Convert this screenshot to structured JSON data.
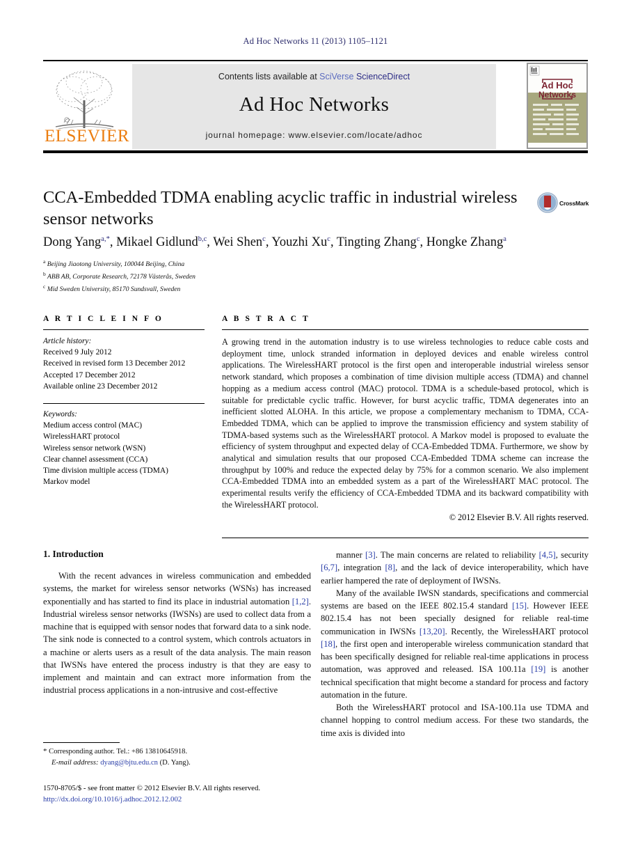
{
  "running_head": "Ad Hoc Networks 11 (2013) 1105–1121",
  "masthead": {
    "contents_prefix": "Contents lists available at ",
    "contents_link_part1": "SciVerse ",
    "contents_link_part2": "ScienceDirect",
    "journal_name": "Ad Hoc Networks",
    "homepage": "journal homepage: www.elsevier.com/locate/adhoc",
    "publisher_wordmark": "ELSEVIER",
    "cover_title_line1": "Ad Hoc",
    "cover_title_line2": "Networks"
  },
  "article": {
    "title": "CCA-Embedded TDMA enabling acyclic traffic in industrial wireless sensor networks",
    "crossmark_label": "CrossMark",
    "authors_html": "Dong Yang<sup>a,*</sup>, Mikael Gidlund<sup>b,c</sup>, Wei Shen<sup>c</sup>, Youzhi Xu<sup>c</sup>, Tingting Zhang<sup>c</sup>, Hongke Zhang<sup>a</sup>",
    "affiliations": [
      {
        "marker": "a",
        "text": "Beijing Jiaotong University, 100044 Beijing, China"
      },
      {
        "marker": "b",
        "text": "ABB AB, Corporate Research, 72178 Västerås, Sweden"
      },
      {
        "marker": "c",
        "text": "Mid Sweden University, 85170 Sundsvall, Sweden"
      }
    ]
  },
  "article_info": {
    "heading": "A R T I C L E  I N F O",
    "history_label": "Article history:",
    "history": [
      "Received 9 July 2012",
      "Received in revised form 13 December 2012",
      "Accepted 17 December 2012",
      "Available online 23 December 2012"
    ],
    "keywords_label": "Keywords:",
    "keywords": [
      "Medium access control (MAC)",
      "WirelessHART protocol",
      "Wireless sensor network (WSN)",
      "Clear channel assessment (CCA)",
      "Time division multiple access (TDMA)",
      "Markov model"
    ]
  },
  "abstract": {
    "heading": "A B S T R A C T",
    "text": "A growing trend in the automation industry is to use wireless technologies to reduce cable costs and deployment time, unlock stranded information in deployed devices and enable wireless control applications. The WirelessHART protocol is the first open and interoperable industrial wireless sensor network standard, which proposes a combination of time division multiple access (TDMA) and channel hopping as a medium access control (MAC) protocol. TDMA is a schedule-based protocol, which is suitable for predictable cyclic traffic. However, for burst acyclic traffic, TDMA degenerates into an inefficient slotted ALOHA. In this article, we propose a complementary mechanism to TDMA, CCA-Embedded TDMA, which can be applied to improve the transmission efficiency and system stability of TDMA-based systems such as the WirelessHART protocol. A Markov model is proposed to evaluate the efficiency of system throughput and expected delay of CCA-Embedded TDMA. Furthermore, we show by analytical and simulation results that our proposed CCA-Embedded TDMA scheme can increase the throughput by 100% and reduce the expected delay by 75% for a common scenario. We also implement CCA-Embedded TDMA into an embedded system as a part of the WirelessHART MAC protocol. The experimental results verify the efficiency of CCA-Embedded TDMA and its backward compatibility with the WirelessHART protocol.",
    "copyright": "© 2012 Elsevier B.V. All rights reserved."
  },
  "body": {
    "section_heading": "1. Introduction",
    "left_paragraphs_html": [
      "With the recent advances in wireless communication and embedded systems, the market for wireless sensor networks (WSNs) has increased exponentially and has started to find its place in industrial automation <span class=\"cite\">[1,2]</span>. Industrial wireless sensor networks (IWSNs) are used to collect data from a machine that is equipped with sensor nodes that forward data to a sink node. The sink node is connected to a control system, which controls actuators in a machine or alerts users as a result of the data analysis. The main reason that IWSNs have entered the process industry is that they are easy to implement and maintain and can extract more information from the industrial process applications in a non-intrusive and cost-effective"
    ],
    "right_paragraphs_html": [
      "manner <span class=\"cite\">[3]</span>. The main concerns are related to reliability <span class=\"cite\">[4,5]</span>, security <span class=\"cite\">[6,7]</span>, integration <span class=\"cite\">[8]</span>, and the lack of device interoperability, which have earlier hampered the rate of deployment of IWSNs.",
      "Many of the available IWSN standards, specifications and commercial systems are based on the IEEE 802.15.4 standard <span class=\"cite\">[15]</span>. However IEEE 802.15.4 has not been specially designed for reliable real-time communication in IWSNs <span class=\"cite\">[13,20]</span>. Recently, the WirelessHART protocol <span class=\"cite\">[18]</span>, the first open and interoperable wireless communication standard that has been specifically designed for reliable real-time applications in process automation, was approved and released. ISA 100.11a <span class=\"cite\">[19]</span> is another technical specification that might become a standard for process and factory automation in the future.",
      "Both the WirelessHART protocol and ISA-100.11a use TDMA and channel hopping to control medium access. For these two standards, the time axis is divided into"
    ]
  },
  "footnote": {
    "star": "*",
    "corresponding": "Corresponding author. Tel.: +86 13810645918.",
    "email_label": "E-mail address:",
    "email": "dyang@bjtu.edu.cn",
    "email_suffix": "(D. Yang)."
  },
  "footer": {
    "issn_line": "1570-8705/$ - see front matter © 2012 Elsevier B.V. All rights reserved.",
    "doi": "http://dx.doi.org/10.1016/j.adhoc.2012.12.002"
  },
  "colors": {
    "link_blue": "#2a3ea8",
    "running_head": "#2b2b6b",
    "elsevier_orange": "#eb7d10",
    "cover_olive": "#a8a87e",
    "cover_maroon": "#7d2433"
  }
}
